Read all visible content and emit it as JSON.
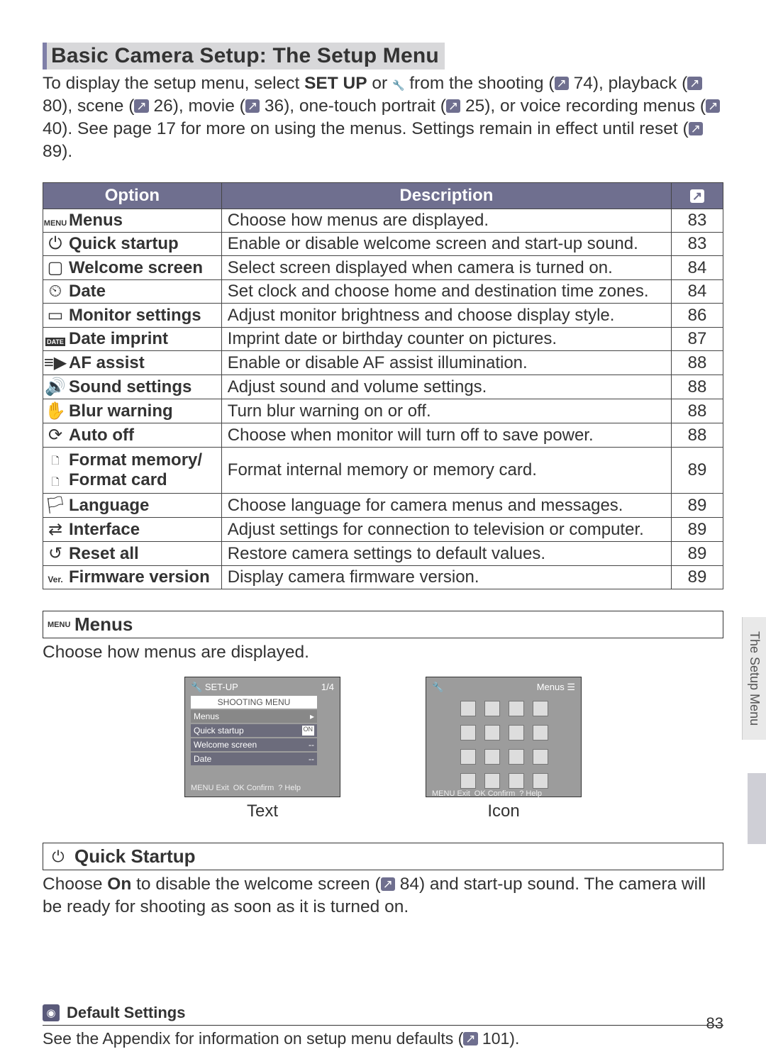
{
  "title": "Basic Camera Setup: The Setup Menu",
  "intro": {
    "t1": "To display the setup menu, select ",
    "setup": "SET UP",
    "t2": " or ",
    "t3": " from the shooting (",
    "p1": "74",
    "t4": "), playback (",
    "p2": "80",
    "t5": "), scene (",
    "p3": "26",
    "t6": "), movie (",
    "p4": "36",
    "t7": "), one-touch portrait (",
    "p5": "25",
    "t8": "), or voice recording menus (",
    "p6": "40",
    "t9": ").  See page 17 for more on using the menus.  Settings remain in effect until reset (",
    "p7": "89",
    "t10": ")."
  },
  "headers": {
    "opt": "Option",
    "desc": "Description"
  },
  "rows": [
    {
      "icon": "MENU",
      "name": "Menus",
      "desc": "Choose how menus are displayed.",
      "page": "83"
    },
    {
      "icon": "⏻",
      "name": "Quick startup",
      "desc": "Enable or disable welcome screen and start-up sound.",
      "page": "83"
    },
    {
      "icon": "▢",
      "name": "Welcome screen",
      "desc": "Select screen displayed when camera is turned on.",
      "page": "84"
    },
    {
      "icon": "⏲",
      "name": "Date",
      "desc": "Set clock and choose home and destination time zones.",
      "page": "84"
    },
    {
      "icon": "▭",
      "name": "Monitor settings",
      "desc": "Adjust monitor brightness and choose display style.",
      "page": "86"
    },
    {
      "icon": "DATE",
      "name": "Date imprint",
      "desc": "Imprint date or birthday counter on pictures.",
      "page": "87"
    },
    {
      "icon": "≡▶",
      "name": "AF assist",
      "desc": "Enable or disable AF assist illumination.",
      "page": "88"
    },
    {
      "icon": "🔊",
      "name": "Sound settings",
      "desc": "Adjust sound and volume settings.",
      "page": "88"
    },
    {
      "icon": "✋",
      "name": "Blur warning",
      "desc": "Turn blur warning on or off.",
      "page": "88"
    },
    {
      "icon": "⟳",
      "name": "Auto off",
      "desc": "Choose when monitor will turn off to save power.",
      "page": "88"
    },
    {
      "icon": "",
      "name": "Format memory/\nFormat card",
      "desc": "Format internal memory or memory card.",
      "page": "89"
    },
    {
      "icon": "🏳",
      "name": "Language",
      "desc": "Choose language for camera menus and messages.",
      "page": "89"
    },
    {
      "icon": "⇄",
      "name": "Interface",
      "desc": "Adjust settings for connection to television or computer.",
      "page": "89"
    },
    {
      "icon": "↺",
      "name": "Reset all",
      "desc": "Restore camera settings to default values.",
      "page": "89"
    },
    {
      "icon": "Ver.",
      "name": "Firmware version",
      "desc": "Display camera firmware version.",
      "page": "89"
    }
  ],
  "sub1": {
    "icon": "MENU",
    "title": "Menus",
    "body": "Choose how menus are displayed."
  },
  "screens": {
    "text": {
      "top": "SET-UP",
      "top_r": "1/4",
      "hdr": "SHOOTING MENU",
      "r1": "Menus",
      "r2": "Quick startup",
      "r3": "Welcome screen",
      "r4": "Date",
      "bottom_exit": "MENU Exit",
      "bottom_ok": "OK Confirm",
      "bottom_help": "? Help",
      "badge_on": "ON",
      "caption": "Text"
    },
    "icon": {
      "top_r": "Menus",
      "bottom_exit": "MENU Exit",
      "bottom_ok": "OK Confirm",
      "bottom_help": "? Help",
      "caption": "Icon"
    }
  },
  "sub2": {
    "icon": "⏻",
    "title": "Quick Startup",
    "b1": "Choose ",
    "on": "On",
    "b2": " to disable the welcome screen (",
    "p": "84",
    "b3": ") and start-up sound.  The camera will be ready for shooting as soon as it is turned on."
  },
  "note": {
    "title": "Default Settings",
    "b1": "See the Appendix for information on setup menu defaults (",
    "p": "101",
    "b2": ")."
  },
  "side": "The Setup Menu",
  "pagenum": "83"
}
